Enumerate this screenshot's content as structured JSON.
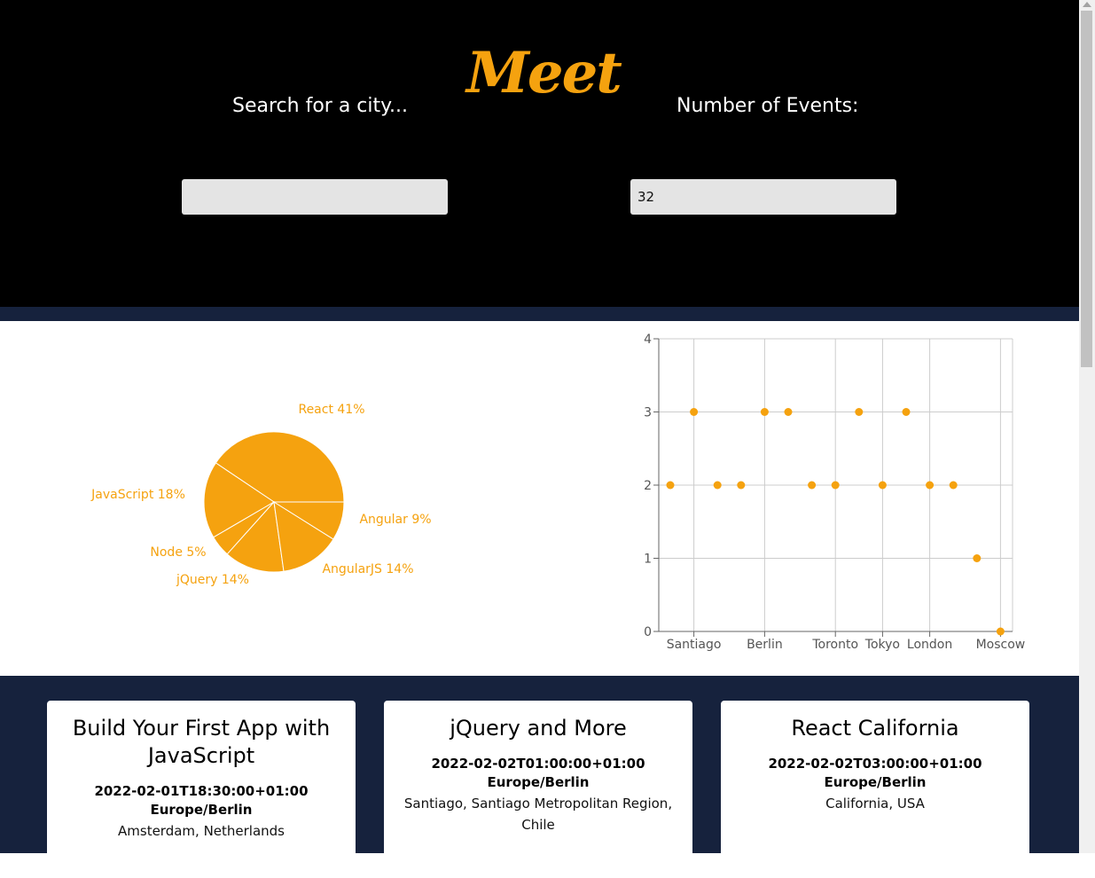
{
  "header": {
    "logo_text": "Meet",
    "city_label": "Search for a city...",
    "city_value": "",
    "events_label": "Number of Events:",
    "events_value": "32"
  },
  "colors": {
    "accent": "#f5a20f",
    "header_bg": "#000000",
    "band_bg": "#16223d",
    "input_bg": "#e4e4e4"
  },
  "chart_data": [
    {
      "type": "pie",
      "categories": [
        "React",
        "JavaScript",
        "Node",
        "jQuery",
        "AngularJS",
        "Angular"
      ],
      "values": [
        41,
        18,
        5,
        14,
        14,
        9
      ],
      "labels": [
        "React 41%",
        "JavaScript 18%",
        "Node 5%",
        "jQuery 14%",
        "AngularJS 14%",
        "Angular 9%"
      ],
      "color": "#f5a20f"
    },
    {
      "type": "scatter",
      "x": [
        "",
        "Santiago",
        "",
        "",
        "Berlin",
        "",
        "",
        "Toronto",
        "",
        "Tokyo",
        "",
        "London",
        "",
        "",
        "Moscow"
      ],
      "y": [
        2,
        3,
        2,
        2,
        3,
        3,
        2,
        2,
        3,
        2,
        3,
        2,
        2,
        1,
        0
      ],
      "xtick_labels": [
        "Santiago",
        "Berlin",
        "Toronto",
        "Tokyo",
        "London",
        "Moscow"
      ],
      "yticks": [
        0,
        1,
        2,
        3,
        4
      ],
      "ylim": [
        0,
        4
      ],
      "grid": true,
      "color": "#f5a20f"
    }
  ],
  "events": [
    {
      "title": "Build Your First App with JavaScript",
      "start": "2022-02-01T18:30:00+01:00 Europe/Berlin",
      "location": "Amsterdam, Netherlands"
    },
    {
      "title": "jQuery and More",
      "start": "2022-02-02T01:00:00+01:00 Europe/Berlin",
      "location": "Santiago, Santiago Metropolitan Region, Chile"
    },
    {
      "title": "React California",
      "start": "2022-02-02T03:00:00+01:00 Europe/Berlin",
      "location": "California, USA"
    }
  ]
}
